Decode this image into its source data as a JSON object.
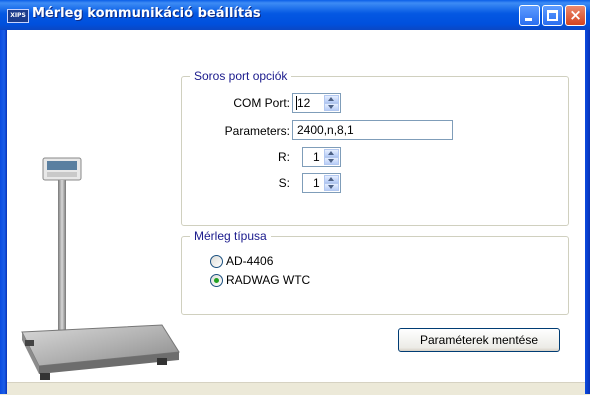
{
  "window": {
    "title": "Mérleg kommunikáció beállítás",
    "app_icon_text": "XIPS",
    "controls": {
      "minimize": "minimize",
      "maximize": "maximize",
      "close": "×"
    }
  },
  "serial_port": {
    "legend": "Soros port opciók",
    "com_port_label": "COM Port:",
    "com_port_value": "12",
    "parameters_label": "Parameters:",
    "parameters_value": "2400,n,8,1",
    "r_label": "R:",
    "r_value": "1",
    "s_label": "S:",
    "s_value": "1"
  },
  "scale_type": {
    "legend": "Mérleg típusa",
    "options": [
      {
        "label": "AD-4406",
        "selected": false
      },
      {
        "label": "RADWAG WTC",
        "selected": true
      }
    ]
  },
  "save_button_label": "Paraméterek mentése",
  "colors": {
    "title_blue": "#0458e3",
    "legend_text": "#1a1a8c",
    "radio_selected": "#21a121"
  }
}
